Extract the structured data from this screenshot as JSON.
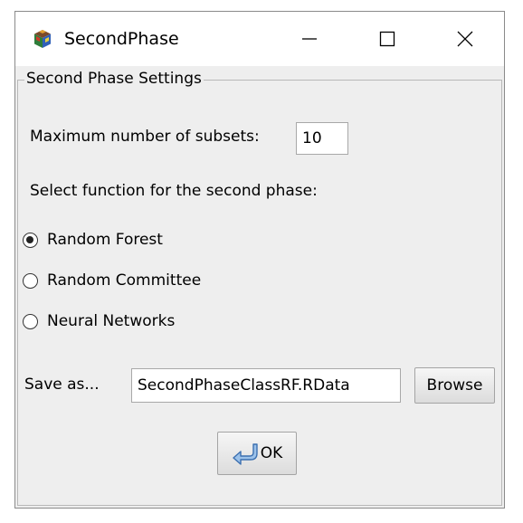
{
  "window": {
    "title": "SecondPhase",
    "app_icon": "java-cube-icon",
    "controls": {
      "minimize": "minimize-icon",
      "maximize": "maximize-icon",
      "close": "close-icon"
    }
  },
  "settings": {
    "group_title": "Second Phase Settings",
    "max_subsets_label": "Maximum number of subsets:",
    "max_subsets_value": "10",
    "function_prompt": "Select function for the second phase:",
    "functions": [
      {
        "label": "Random Forest",
        "selected": true
      },
      {
        "label": "Random Committee",
        "selected": false
      },
      {
        "label": "Neural Networks",
        "selected": false
      }
    ],
    "save_as_label": "Save as...",
    "save_as_value": "SecondPhaseClassRF.RData",
    "browse_label": "Browse",
    "ok_label": "OK",
    "ok_icon": "return-arrow-icon"
  }
}
